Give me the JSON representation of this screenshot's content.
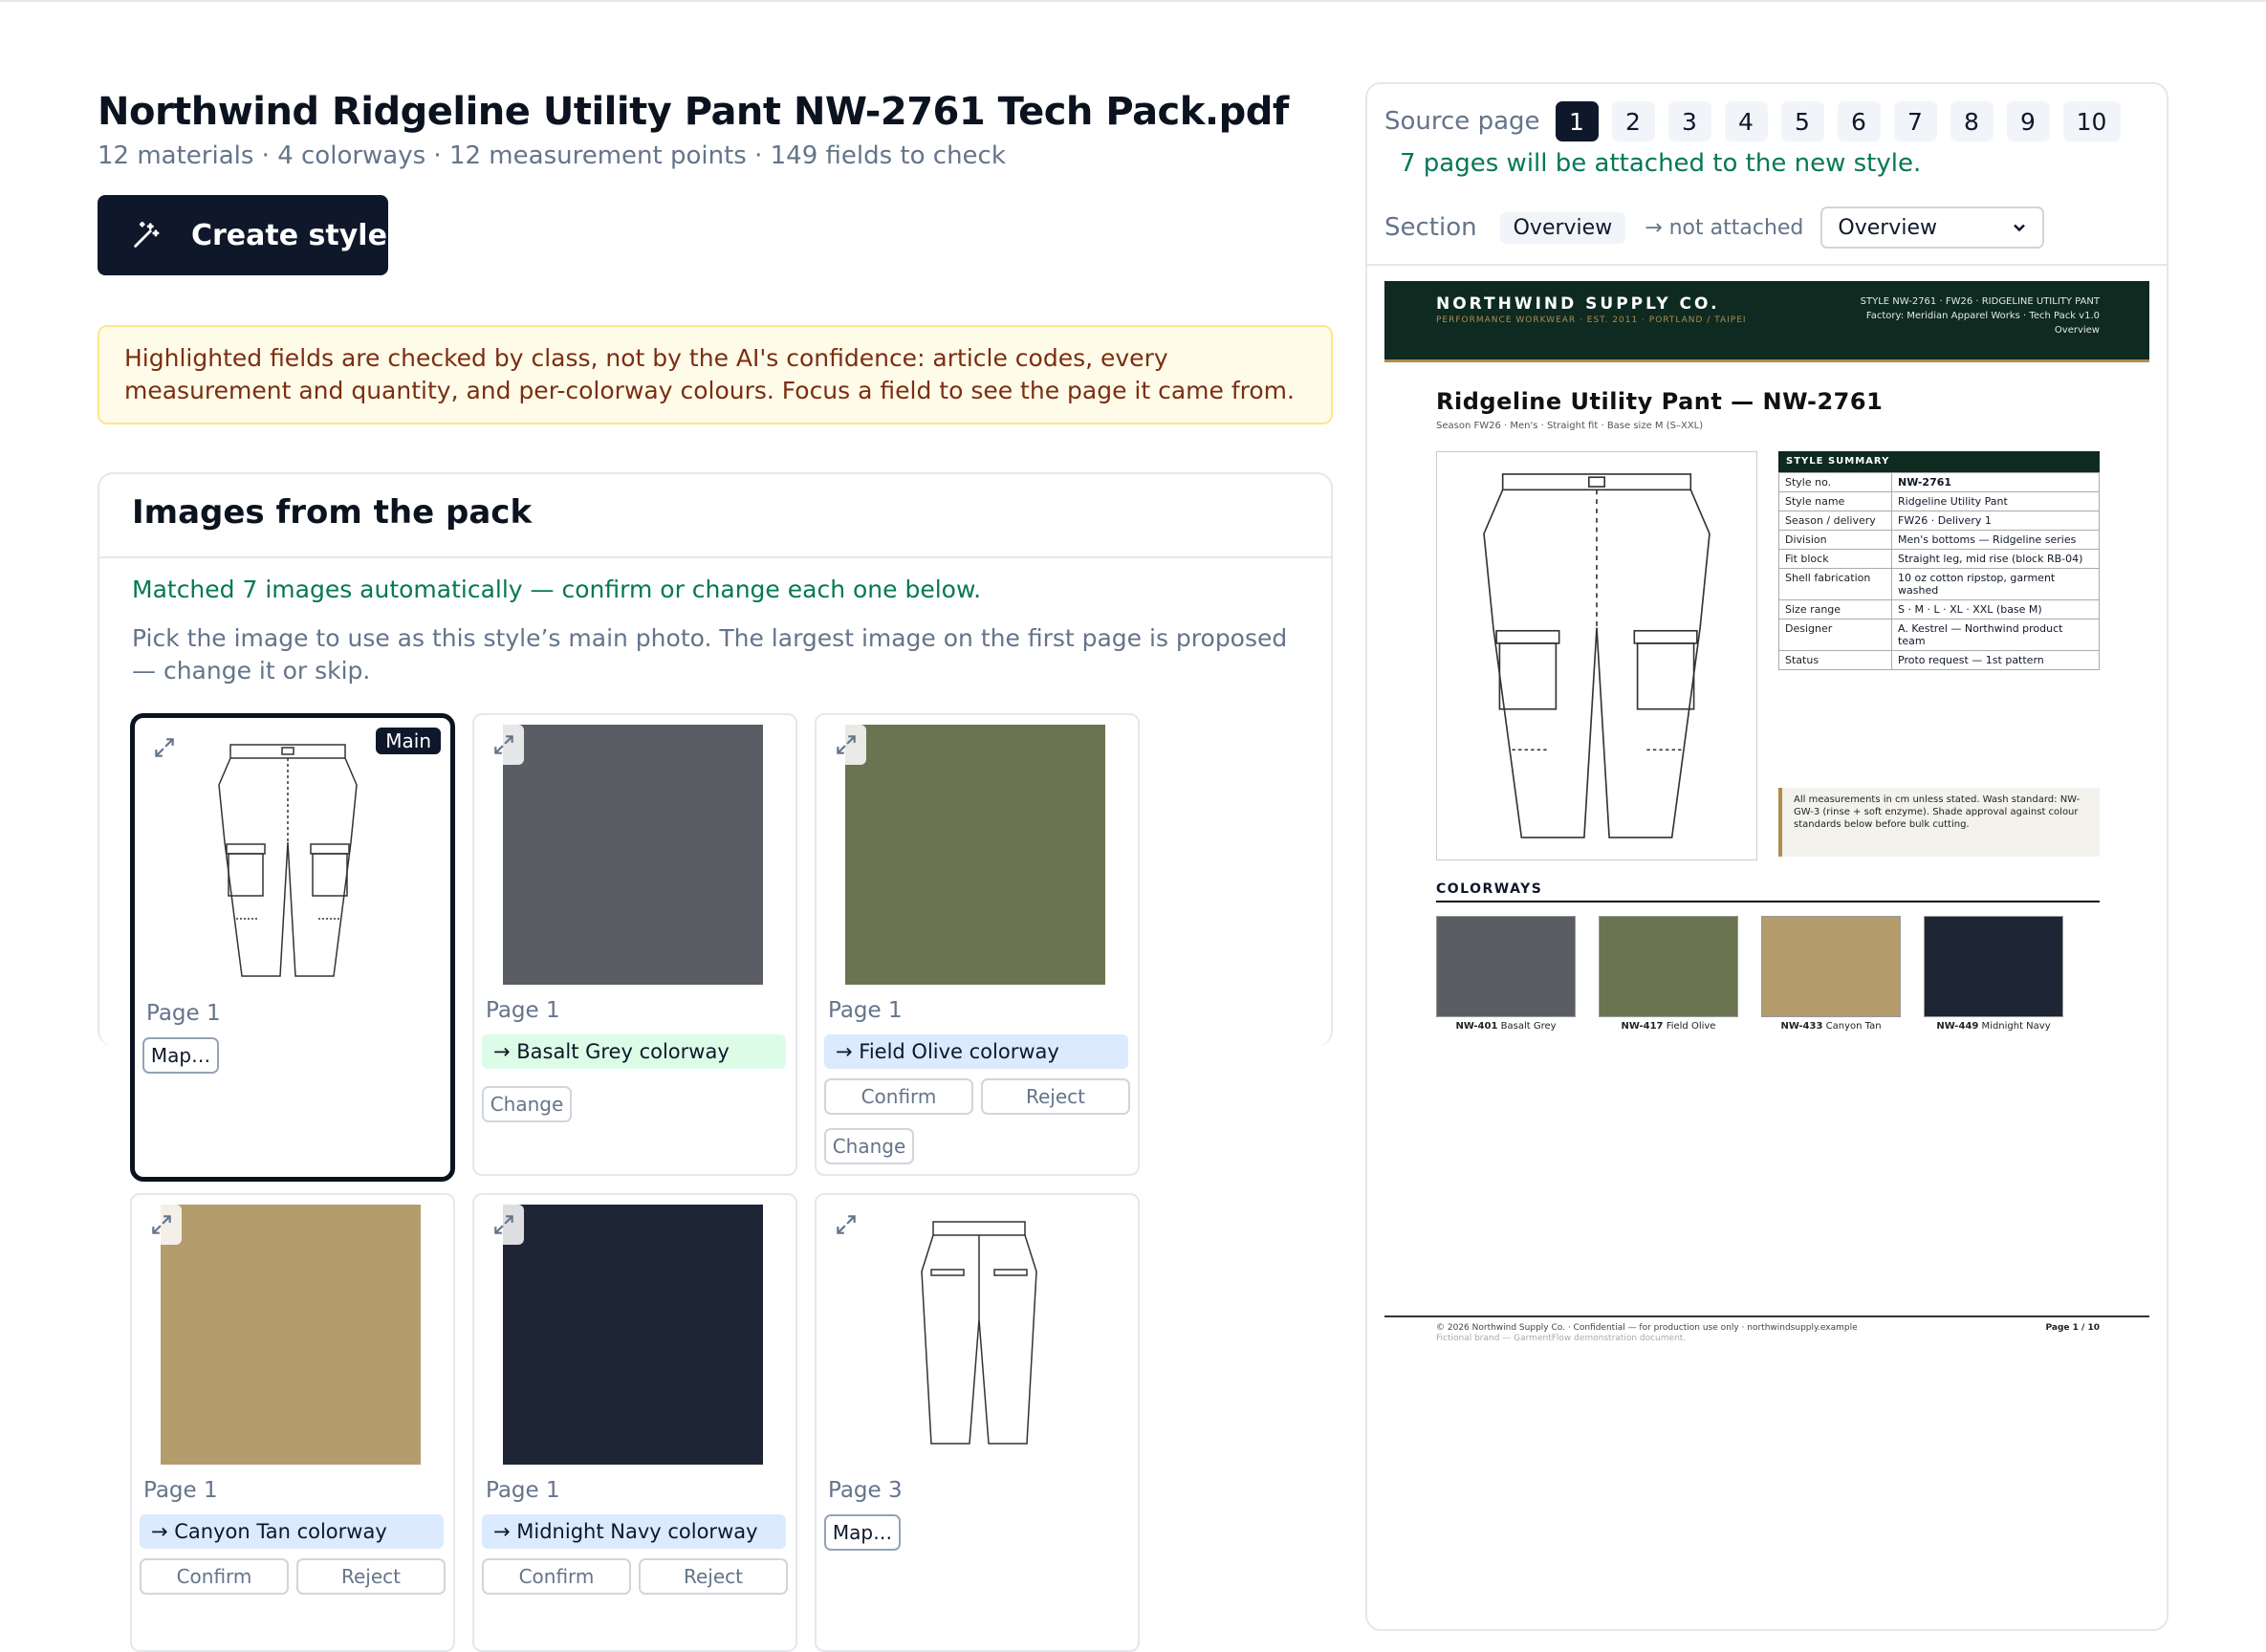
{
  "header": {
    "title": "Northwind Ridgeline Utility Pant NW-2761 Tech Pack.pdf",
    "subtitle": "12 materials · 4 colorways · 12 measurement points · 149 fields to check",
    "create_label": "Create style"
  },
  "notice": "Highlighted fields are checked by class, not by the AI's confidence: article codes, every measurement and quantity, and per-colorway colours. Focus a field to see the page it came from.",
  "images_panel": {
    "title": "Images from the pack",
    "matched": "Matched 7 images automatically — confirm or change each one below.",
    "pick": "Pick the image to use as this style’s main photo. The largest image on the first page is proposed — change it or skip.",
    "main_badge": "Main",
    "map_label": "Map…",
    "change_label": "Change",
    "confirm_label": "Confirm",
    "reject_label": "Reject",
    "cards": [
      {
        "page": "Page 1",
        "chip": ""
      },
      {
        "page": "Page 1",
        "chip": "→ Basalt Grey colorway",
        "color": "#5a5d63"
      },
      {
        "page": "Page 1",
        "chip": "→ Field Olive colorway",
        "color": "#6b7450"
      },
      {
        "page": "Page 1",
        "chip": "→ Canyon Tan colorway",
        "color": "#b49c6c"
      },
      {
        "page": "Page 1",
        "chip": "→ Midnight Navy colorway",
        "color": "#1e2535"
      },
      {
        "page": "Page 3",
        "chip": ""
      }
    ]
  },
  "source": {
    "label": "Source page",
    "pages": [
      "1",
      "2",
      "3",
      "4",
      "5",
      "6",
      "7",
      "8",
      "9",
      "10"
    ],
    "attached": "7 pages will be attached to the new style.",
    "section_label": "Section",
    "section_chip": "Overview",
    "not_attached": "→ not attached",
    "section_select": "Overview"
  },
  "doc": {
    "brand": "NORTHWIND SUPPLY CO.",
    "brand_sub": "PERFORMANCE WORKWEAR · EST. 2011 · PORTLAND / TAIPEI",
    "head_right_1": "STYLE NW-2761 · FW26 · RIDGELINE UTILITY PANT",
    "head_right_2": "Factory: Meridian Apparel Works · Tech Pack v1.0",
    "head_right_3": "Overview",
    "title": "Ridgeline Utility Pant — NW-2761",
    "sub": "Season FW26 · Men's · Straight fit · Base size M (S–XXL)",
    "summary_title": "STYLE SUMMARY",
    "summary": [
      {
        "k": "Style no.",
        "v": "NW-2761"
      },
      {
        "k": "Style name",
        "v": "Ridgeline Utility Pant"
      },
      {
        "k": "Season / delivery",
        "v": "FW26 · Delivery 1"
      },
      {
        "k": "Division",
        "v": "Men's bottoms — Ridgeline series"
      },
      {
        "k": "Fit block",
        "v": "Straight leg, mid rise (block RB-04)"
      },
      {
        "k": "Shell fabrication",
        "v": "10 oz cotton ripstop, garment washed"
      },
      {
        "k": "Size range",
        "v": "S · M · L · XL · XXL (base M)"
      },
      {
        "k": "Designer",
        "v": "A. Kestrel — Northwind product team"
      },
      {
        "k": "Status",
        "v": "Proto request — 1st pattern"
      }
    ],
    "note": "All measurements in cm unless stated. Wash standard: NW-GW-3 (rinse + soft enzyme). Shade approval against colour standards below before bulk cutting.",
    "colorways_title": "COLORWAYS",
    "colorways": [
      {
        "code": "NW-401",
        "name": "Basalt Grey",
        "color": "#5a5d63"
      },
      {
        "code": "NW-417",
        "name": "Field Olive",
        "color": "#6b7450"
      },
      {
        "code": "NW-433",
        "name": "Canyon Tan",
        "color": "#b49c6c"
      },
      {
        "code": "NW-449",
        "name": "Midnight Navy",
        "color": "#1e2535"
      }
    ],
    "footer_left": "© 2026 Northwind Supply Co. · Confidential — for production use only · northwindsupply.example",
    "footer_left2": "Fictional brand — GarmentFlow demonstration document.",
    "footer_right": "Page 1 / 10"
  }
}
